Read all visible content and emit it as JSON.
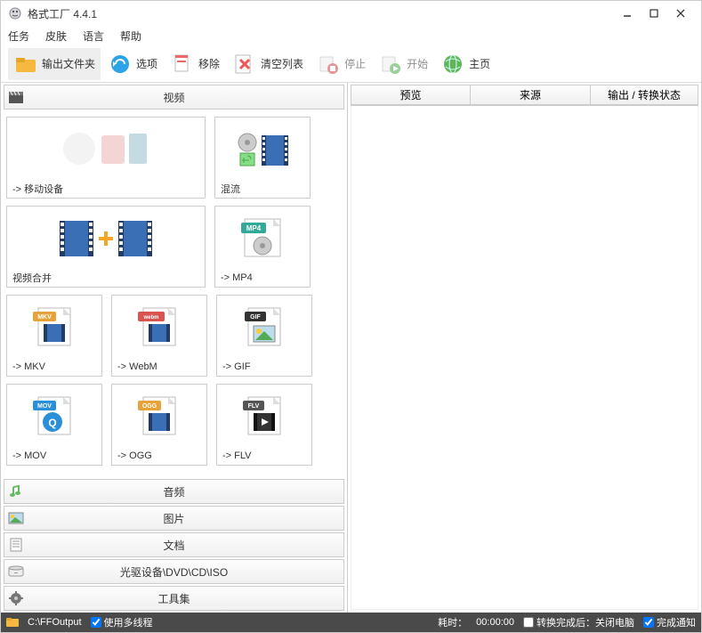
{
  "app": {
    "title": "格式工厂 4.4.1"
  },
  "menu": {
    "task": "任务",
    "skin": "皮肤",
    "language": "语言",
    "help": "帮助"
  },
  "toolbar": {
    "output_folder": "输出文件夹",
    "options": "选项",
    "remove": "移除",
    "clear_list": "清空列表",
    "stop": "停止",
    "start": "开始",
    "home": "主页"
  },
  "categories": {
    "video": "视频",
    "audio": "音频",
    "picture": "图片",
    "document": "文档",
    "disc": "光驱设备\\DVD\\CD\\ISO",
    "tools": "工具集"
  },
  "tiles": {
    "mobile": "-> 移动设备",
    "mux": "混流",
    "join": "视频合并",
    "mp4": "-> MP4",
    "mkv": "-> MKV",
    "webm": "-> WebM",
    "gif": "-> GIF",
    "mov": "-> MOV",
    "ogg": "-> OGG",
    "flv": "-> FLV"
  },
  "list_columns": {
    "preview": "预览",
    "source": "来源",
    "output": "输出 / 转换状态"
  },
  "status": {
    "output_path": "C:\\FFOutput",
    "multithread": "使用多线程",
    "elapsed_label": "耗时：",
    "elapsed_value": "00:00:00",
    "shutdown": "转换完成后：关闭电脑",
    "notify": "完成通知"
  },
  "colors": {
    "status_bg": "#4a4a4a"
  }
}
